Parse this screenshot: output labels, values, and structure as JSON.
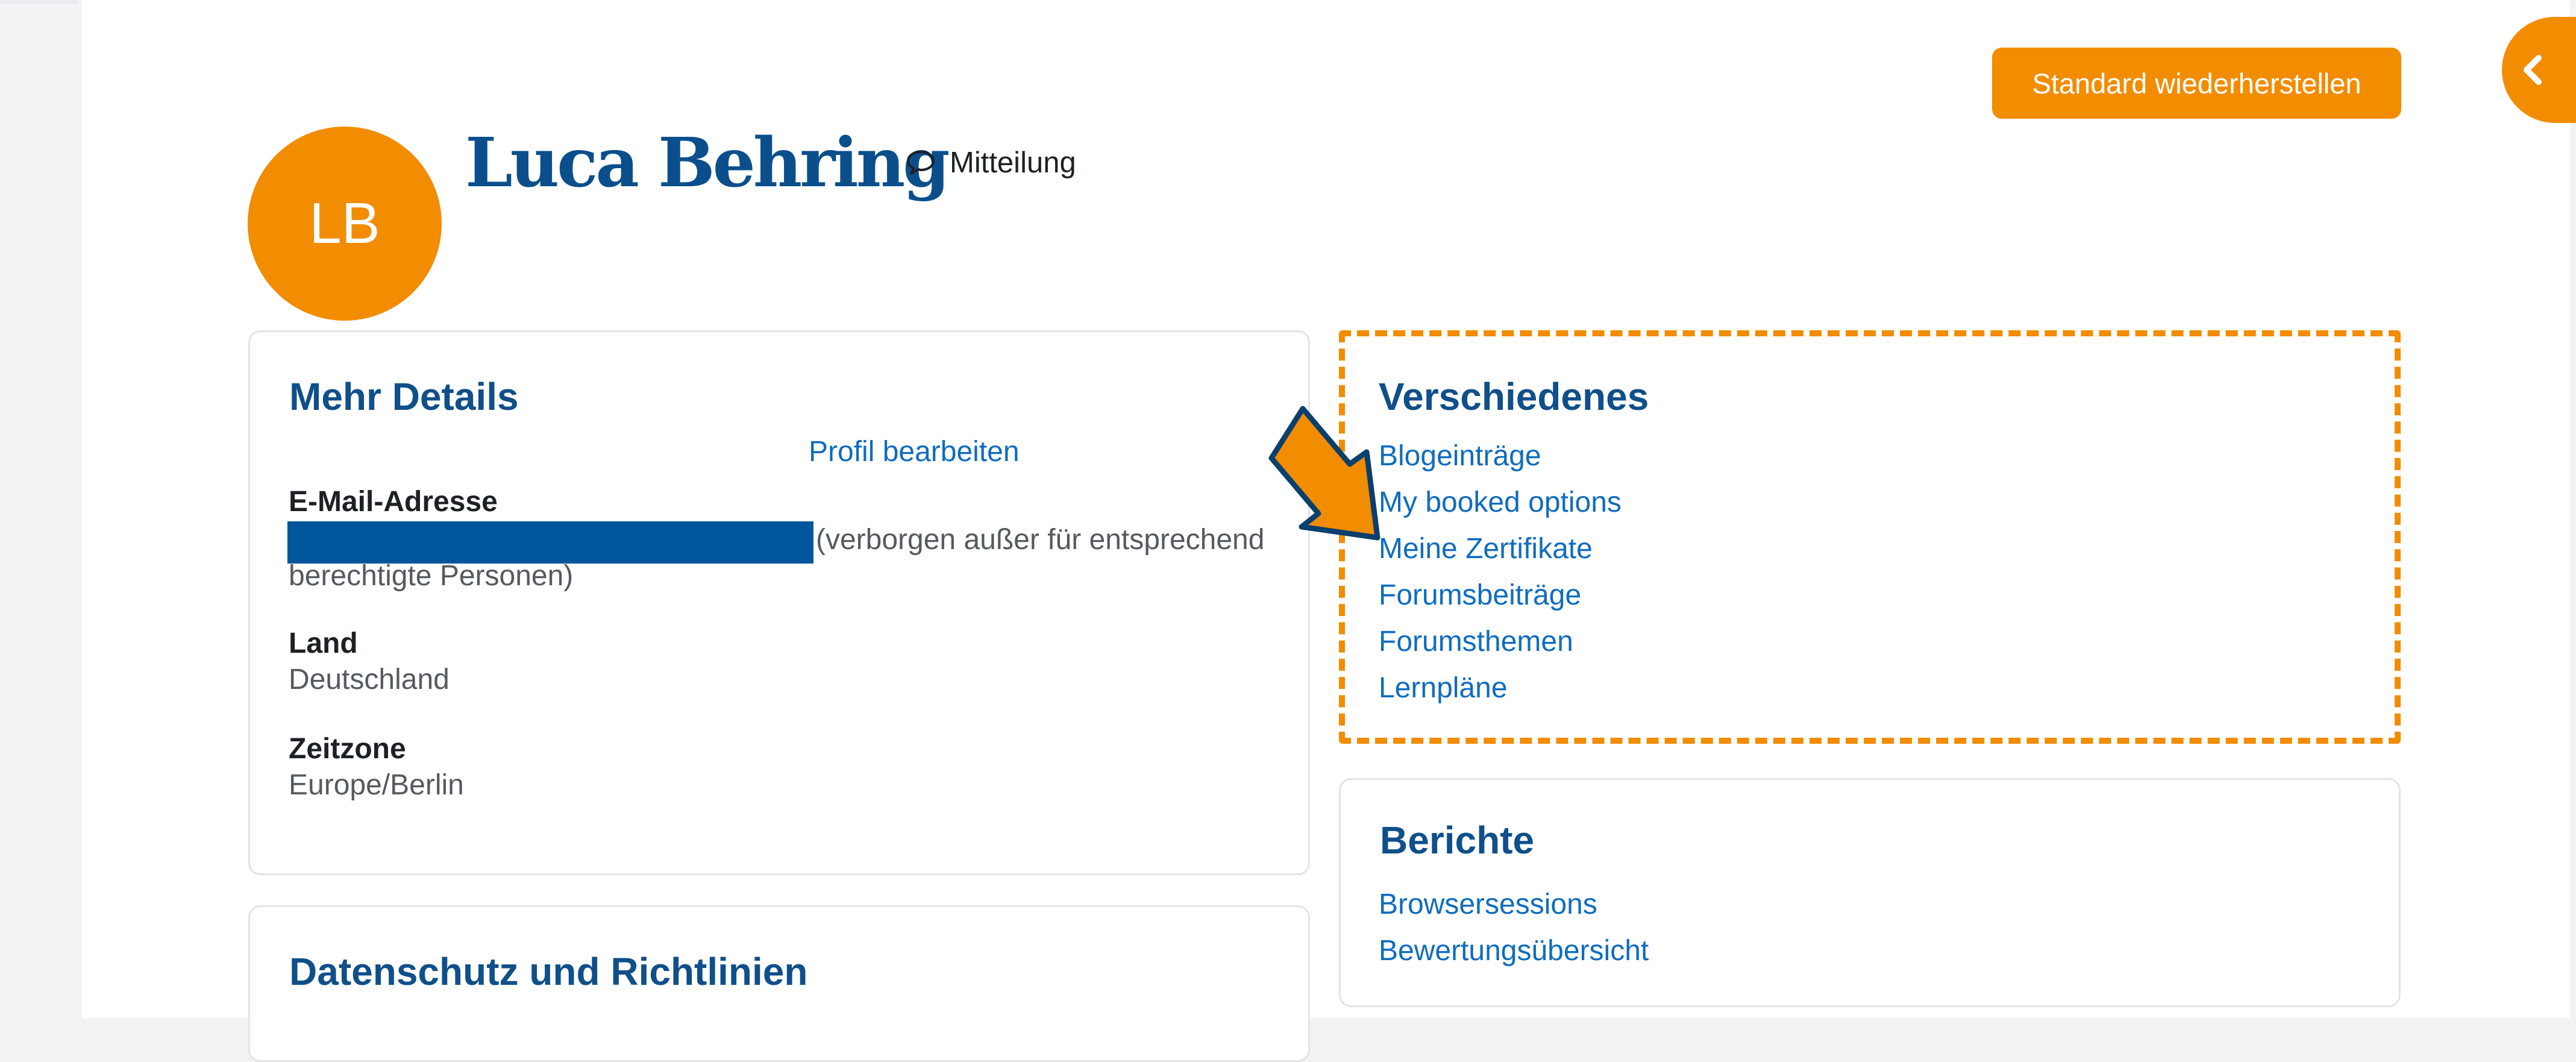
{
  "window": {
    "restore_button": "Standard wiederherstellen"
  },
  "header": {
    "avatar_initials": "LB",
    "user_name": "Luca Behring",
    "message_label": "Mitteilung"
  },
  "details": {
    "title": "Mehr Details",
    "edit_link": "Profil bearbeiten",
    "email_label": "E-Mail-Adresse",
    "email_note_line1": "(verborgen außer für entsprechend",
    "email_note_line2": "berechtigte Personen)",
    "country_label": "Land",
    "country_value": "Deutschland",
    "timezone_label": "Zeitzone",
    "timezone_value": "Europe/Berlin"
  },
  "privacy": {
    "title": "Datenschutz und Richtlinien"
  },
  "misc": {
    "title": "Verschiedenes",
    "links": [
      "Blogeinträge",
      "My booked options",
      "Meine Zertifikate",
      "Forumsbeiträge",
      "Forumsthemen",
      "Lernpläne"
    ]
  },
  "reports": {
    "title": "Berichte",
    "links": [
      "Browsersessions",
      "Bewertungsübersicht"
    ]
  },
  "colors": {
    "accent_orange": "#f28c00",
    "heading_blue": "#0f4f8a",
    "link_blue": "#0f6cbf",
    "redaction_blue": "#00569a"
  },
  "icons": {
    "message": "speech-bubble-icon",
    "drawer": "chevron-left-icon",
    "annotation": "pointer-arrow-icon"
  }
}
